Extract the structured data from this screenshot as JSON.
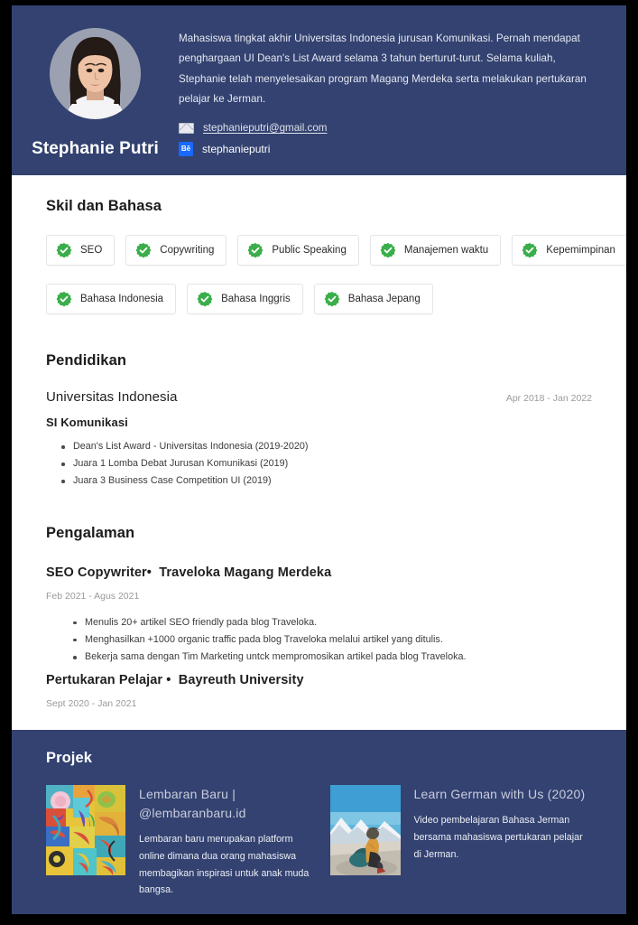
{
  "theme": {
    "navy": "#334270",
    "white": "#ffffff",
    "green_badge": "#3aae4a",
    "behance_blue": "#1769ff",
    "muted_text": "#9a9a9a",
    "project_title": "#c8ccdd",
    "page_border": "#000000"
  },
  "header": {
    "avatar_alt": "avatar-photo",
    "name": "Stephanie Putri",
    "bio": "Mahasiswa tingkat akhir Universitas Indonesia jurusan Komunikasi. Pernah mendapat penghargaan UI Dean's List Award selama 3 tahun berturut-turut. Selama kuliah, Stephanie telah menyelesaikan program Magang Merdeka serta melakukan pertukaran pelajar ke Jerman.",
    "email": {
      "icon": "mail-icon",
      "value": "stephanieputri@gmail.com"
    },
    "behance": {
      "icon": "behance-icon",
      "icon_glyph": "Bē",
      "value": "stephanieputri"
    }
  },
  "skills": {
    "title": "Skil dan Bahasa",
    "badge_icon": "verified-check-icon",
    "row1": [
      {
        "label": "SEO"
      },
      {
        "label": "Copywriting"
      },
      {
        "label": "Public Speaking"
      },
      {
        "label": "Manajemen waktu"
      },
      {
        "label": "Kepemimpinan"
      }
    ],
    "row2": [
      {
        "label": "Bahasa Indonesia"
      },
      {
        "label": "Bahasa Inggris"
      },
      {
        "label": "Bahasa Jepang"
      }
    ]
  },
  "education": {
    "title": "Pendidikan",
    "entries": [
      {
        "school": "Universitas Indonesia",
        "dates": "Apr 2018 - Jan 2022",
        "degree": "SI Komunikasi",
        "bullets": [
          "Dean's List Award - Universitas Indonesia (2019-2020)",
          "Juara 1 Lomba Debat Jurusan Komunikasi (2019)",
          "Juara 3 Business Case Competition UI (2019)"
        ]
      }
    ]
  },
  "experience": {
    "title": "Pengalaman",
    "entries": [
      {
        "role": "SEO Copywriter",
        "separator": "•",
        "company": "Traveloka Magang Merdeka",
        "dates": "Feb 2021 - Agus 2021",
        "bullets": [
          "Menulis 20+ artikel SEO friendly pada blog Traveloka.",
          "Menghasilkan +1000 organic traffic pada blog Traveloka melalui artikel yang ditulis.",
          "Bekerja sama dengan Tim Marketing untck mempromosikan artikel pada blog Traveloka."
        ]
      },
      {
        "role": "Pertukaran Pelajar",
        "separator": "•",
        "company": "Bayreuth University",
        "dates": "Sept 2020 - Jan 2021",
        "bullets": []
      }
    ]
  },
  "projects": {
    "title": "Projek",
    "items": [
      {
        "thumbnail": "doodle-art-thumbnail",
        "title": "Lembaran Baru | @lembaranbaru.id",
        "description": "Lembaran baru merupakan platform online dimana dua orang mahasiswa membagikan inspirasi untuk anak muda bangsa."
      },
      {
        "thumbnail": "mountain-traveler-thumbnail",
        "title": "Learn German with Us (2020)",
        "description": "Video pembelajaran Bahasa Jerman bersama mahasiswa pertukaran pelajar di Jerman."
      }
    ]
  }
}
